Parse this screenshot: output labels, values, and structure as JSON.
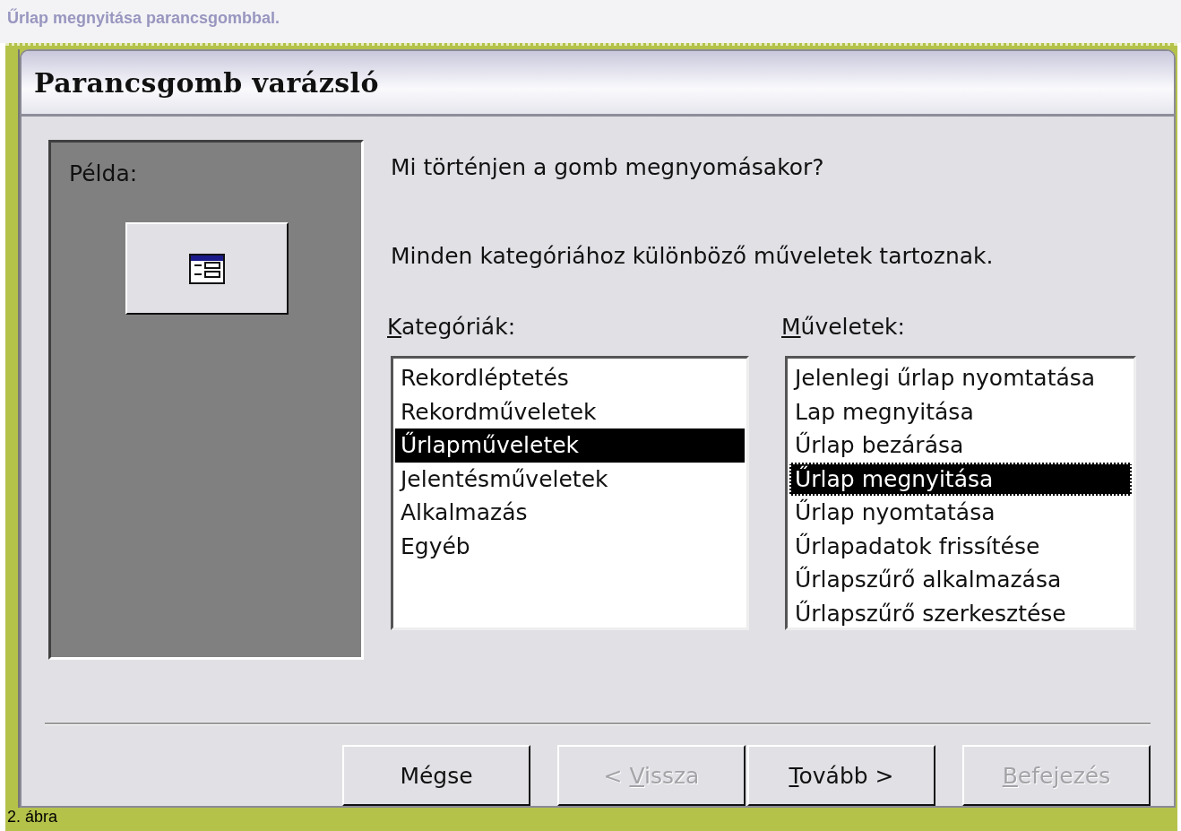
{
  "caption": "Űrlap megnyitása parancsgombbal.",
  "dialog": {
    "title": "Parancsgomb varázsló",
    "preview": {
      "label": "Példa:"
    },
    "question": "Mi történjen a gomb megnyomásakor?",
    "hint": "Minden kategóriához különböző műveletek tartoznak.",
    "categories": {
      "label": {
        "key": "K",
        "after": "ategóriák:"
      },
      "items": [
        {
          "label": "Rekordléptetés",
          "selected": false
        },
        {
          "label": "Rekordműveletek",
          "selected": false
        },
        {
          "label": "Űrlapműveletek",
          "selected": true
        },
        {
          "label": "Jelentésműveletek",
          "selected": false
        },
        {
          "label": "Alkalmazás",
          "selected": false
        },
        {
          "label": "Egyéb",
          "selected": false
        }
      ]
    },
    "actions": {
      "label": {
        "key": "M",
        "after": "űveletek:"
      },
      "items": [
        {
          "label": "Jelenlegi űrlap nyomtatása",
          "selected": false
        },
        {
          "label": "Lap megnyitása",
          "selected": false
        },
        {
          "label": "Űrlap bezárása",
          "selected": false
        },
        {
          "label": "Űrlap megnyitása",
          "selected": true
        },
        {
          "label": "Űrlap nyomtatása",
          "selected": false
        },
        {
          "label": "Űrlapadatok frissítése",
          "selected": false
        },
        {
          "label": "Űrlapszűrő alkalmazása",
          "selected": false
        },
        {
          "label": "Űrlapszűrő szerkesztése",
          "selected": false
        }
      ]
    },
    "buttons": [
      {
        "before": "Mégse",
        "disabled": false
      },
      {
        "before": "< ",
        "key": "V",
        "after": "issza",
        "disabled": true
      },
      {
        "key": "T",
        "after": "ovább >",
        "disabled": false
      },
      {
        "key": "B",
        "after": "efejezés",
        "disabled": true
      }
    ]
  },
  "figure_caption": "2. ábra"
}
